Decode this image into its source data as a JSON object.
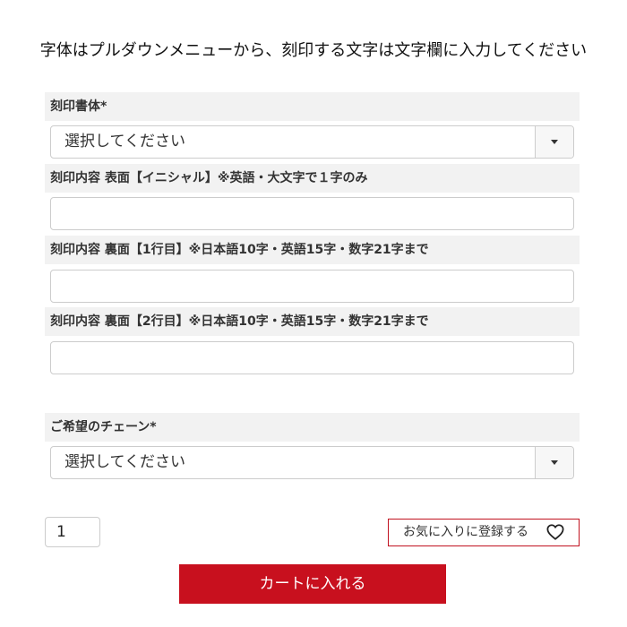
{
  "instruction": "字体はプルダウンメニューから、刻印する文字は文字欄に入力してください",
  "fields": {
    "font": {
      "label": "刻印書体*",
      "selected": "選択してください"
    },
    "front_initial": {
      "label": "刻印内容 表面【イニシャル】※英語・大文字で１字のみ",
      "value": ""
    },
    "back_line1": {
      "label": "刻印内容 裏面【1行目】※日本語10字・英語15字・数字21字まで",
      "value": ""
    },
    "back_line2": {
      "label": "刻印内容 裏面【2行目】※日本語10字・英語15字・数字21字まで",
      "value": ""
    },
    "chain": {
      "label": "ご希望のチェーン*",
      "selected": "選択してください"
    }
  },
  "quantity": "1",
  "favorite_label": "お気に入りに登録する",
  "cart_label": "カートに入れる",
  "icons": {
    "dropdown": "chevron-down-icon",
    "favorite": "heart-icon"
  },
  "colors": {
    "accent": "#c8101e",
    "label_bg": "#f2f2f2",
    "border": "#cccccc"
  }
}
